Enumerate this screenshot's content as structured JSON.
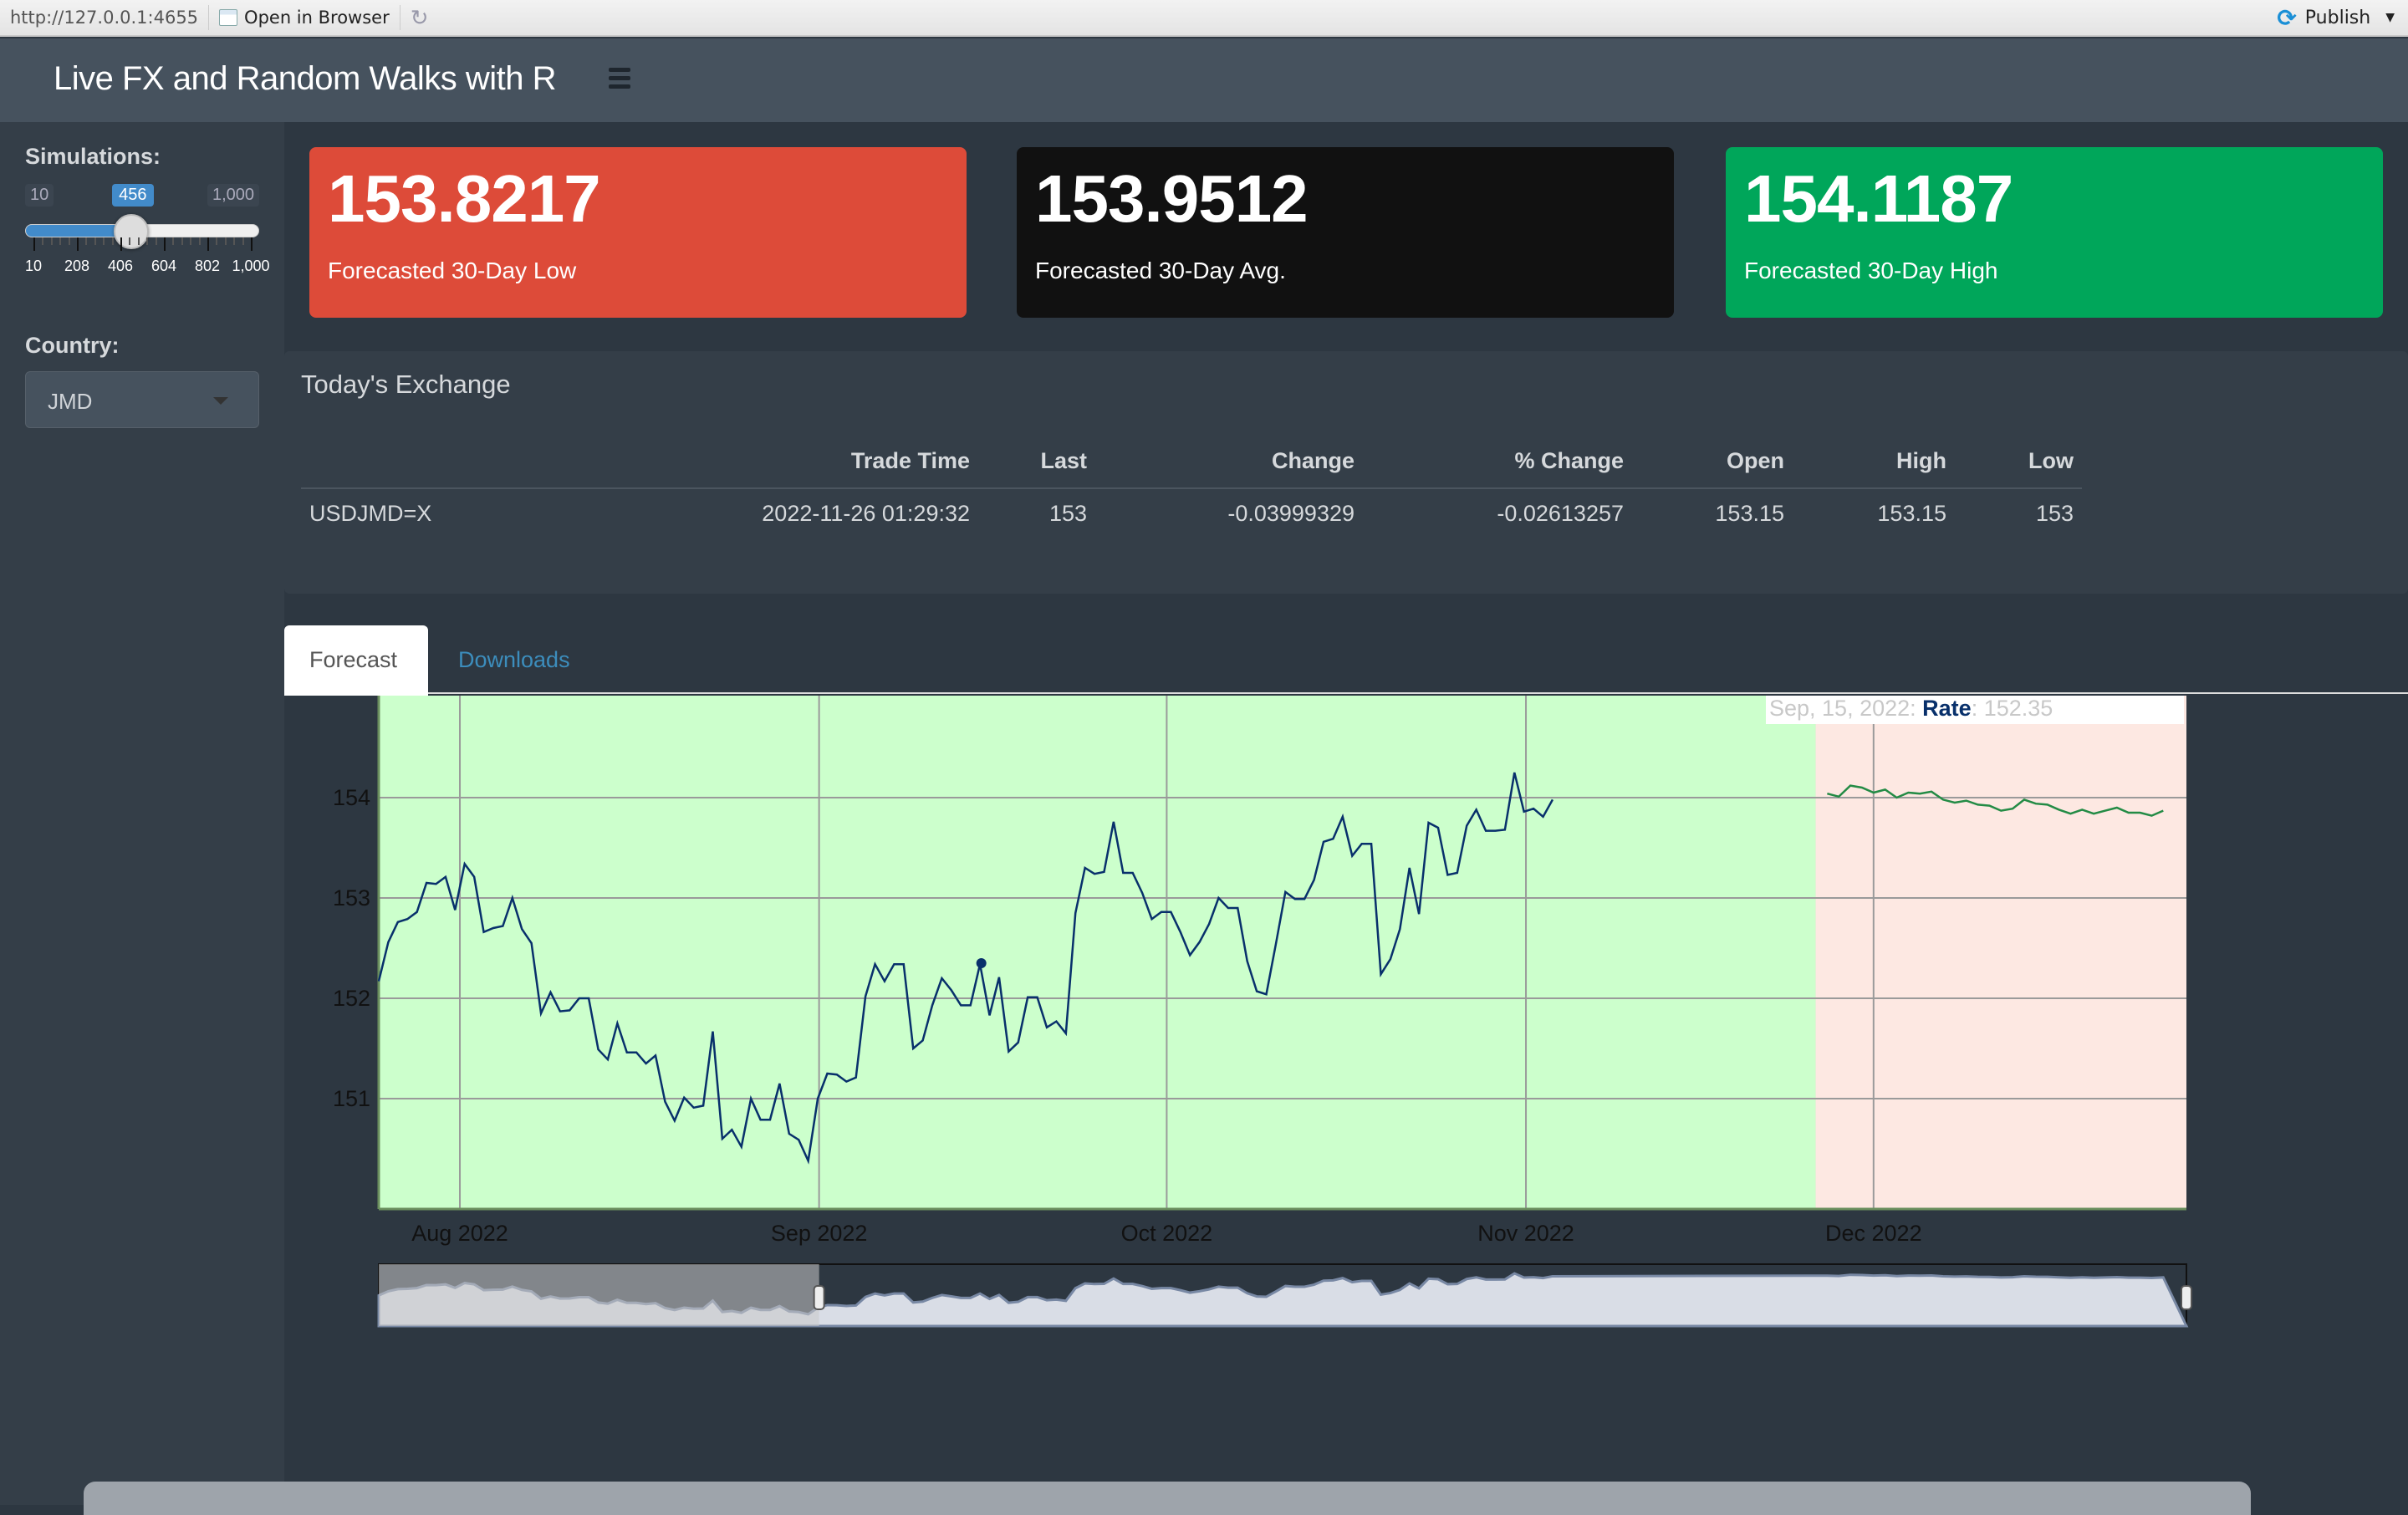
{
  "ide": {
    "url": "http://127.0.0.1:4655",
    "open_in_browser": "Open in Browser",
    "publish": "Publish"
  },
  "app": {
    "title": "Live FX and Random Walks with R"
  },
  "sidebar": {
    "simulations_label": "Simulations:",
    "slider": {
      "min": 10,
      "max": 1000,
      "value": 456,
      "min_label": "10",
      "max_label": "1,000",
      "value_label": "456",
      "tick_labels": [
        "10",
        "208",
        "406",
        "604",
        "802",
        "1,000"
      ]
    },
    "country_label": "Country:",
    "country_value": "JMD"
  },
  "value_boxes": [
    {
      "value": "153.8217",
      "caption": "Forecasted 30-Day Low",
      "color": "#dd4b39"
    },
    {
      "value": "153.9512",
      "caption": "Forecasted 30-Day Avg.",
      "color": "#111111"
    },
    {
      "value": "154.1187",
      "caption": "Forecasted 30-Day High",
      "color": "#00a65a"
    }
  ],
  "exchange": {
    "title": "Today's Exchange",
    "columns": [
      "",
      "Trade Time",
      "Last",
      "Change",
      "% Change",
      "Open",
      "High",
      "Low"
    ],
    "rows": [
      [
        "USDJMD=X",
        "2022-11-26 01:29:32",
        "153",
        "-0.03999329",
        "-0.02613257",
        "153.15",
        "153.15",
        "153"
      ]
    ]
  },
  "tabs": [
    {
      "label": "Forecast",
      "active": true
    },
    {
      "label": "Downloads",
      "active": false
    }
  ],
  "chart_data": {
    "type": "line",
    "title": "",
    "xlabel": "",
    "ylabel": "",
    "ylim": [
      149.9,
      154.65
    ],
    "yticks": [
      151,
      152,
      153,
      154
    ],
    "x_range": [
      "2022-07-25",
      "2022-12-28"
    ],
    "xticks": [
      {
        "date": "2022-08-01",
        "label": "Aug 2022"
      },
      {
        "date": "2022-09-01",
        "label": "Sep 2022"
      },
      {
        "date": "2022-10-01",
        "label": "Oct 2022"
      },
      {
        "date": "2022-11-01",
        "label": "Nov 2022"
      },
      {
        "date": "2022-12-01",
        "label": "Dec 2022"
      }
    ],
    "grid": true,
    "shading": [
      {
        "name": "history",
        "from": "2022-07-25",
        "to": "2022-11-26",
        "color": "#ccffcc"
      },
      {
        "name": "forecast",
        "from": "2022-11-26",
        "to": "2022-12-28",
        "color": "#fde8e2"
      }
    ],
    "tooltip": {
      "date": "Sep, 15, 2022",
      "series": "Rate",
      "value": "152.35"
    },
    "highlight_point": {
      "date": "2022-09-15",
      "value": 152.35
    },
    "series": [
      {
        "name": "Rate",
        "color": "#08306b",
        "start": "2022-07-25",
        "step_days": 0.8236,
        "values": [
          152.17,
          152.56,
          152.76,
          152.79,
          152.86,
          153.15,
          153.14,
          153.21,
          152.88,
          153.34,
          153.21,
          152.66,
          152.7,
          152.72,
          153.0,
          152.69,
          152.55,
          151.85,
          152.06,
          151.87,
          151.88,
          152.0,
          152.0,
          151.49,
          151.39,
          151.75,
          151.46,
          151.46,
          151.35,
          151.43,
          150.97,
          150.78,
          151.01,
          150.91,
          150.93,
          151.67,
          150.6,
          150.69,
          150.52,
          151.0,
          150.79,
          150.79,
          151.15,
          150.65,
          150.59,
          150.38,
          151.0,
          151.25,
          151.24,
          151.17,
          151.21,
          152.02,
          152.34,
          152.17,
          152.34,
          152.34,
          151.5,
          151.58,
          151.93,
          152.2,
          152.08,
          151.93,
          151.93,
          152.34,
          151.83,
          152.21,
          151.47,
          151.56,
          152.01,
          152.01,
          151.71,
          151.77,
          151.65,
          152.85,
          153.3,
          153.24,
          153.26,
          153.76,
          153.25,
          153.25,
          153.05,
          152.79,
          152.86,
          152.86,
          152.66,
          152.43,
          152.56,
          152.74,
          153.0,
          152.9,
          152.9,
          152.37,
          152.07,
          152.04,
          152.54,
          153.06,
          152.99,
          152.99,
          153.18,
          153.56,
          153.59,
          153.81,
          153.42,
          153.54,
          153.54,
          152.24,
          152.39,
          152.69,
          153.3,
          152.84,
          153.75,
          153.7,
          153.23,
          153.25,
          153.72,
          153.88,
          153.67,
          153.67,
          153.68,
          154.25,
          153.86,
          153.89,
          153.81,
          153.98
        ]
      },
      {
        "name": "Forecast",
        "color": "#238b45",
        "start": "2022-11-27",
        "step_days": 1,
        "values": [
          154.04,
          154.01,
          154.12,
          154.1,
          154.05,
          154.08,
          154.0,
          154.05,
          154.04,
          154.06,
          153.98,
          153.95,
          153.97,
          153.93,
          153.92,
          153.87,
          153.89,
          153.98,
          153.94,
          153.93,
          153.88,
          153.84,
          153.88,
          153.84,
          153.87,
          153.9,
          153.85,
          153.85,
          153.82,
          153.87
        ]
      }
    ],
    "range_selector": {
      "from": "2022-09-01",
      "to": "2022-12-28"
    }
  }
}
